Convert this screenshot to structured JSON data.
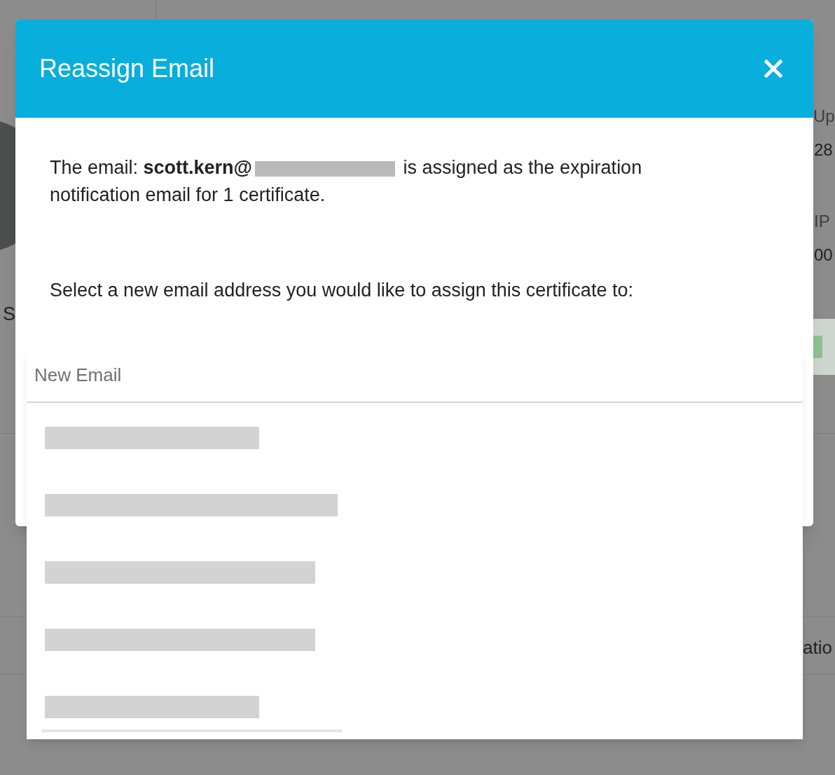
{
  "background_page": {
    "labels": [
      {
        "text": "Up",
        "kind": "label"
      },
      {
        "text": "28",
        "kind": "value"
      },
      {
        "text": "IP",
        "kind": "label"
      },
      {
        "text": "00",
        "kind": "value"
      }
    ],
    "left_label": "S",
    "lower_label": "atio"
  },
  "dialog": {
    "title": "Reassign Email",
    "message_before": "The email: **scott.kern@**",
    "message_after": "is assigned as the expiration notification email for 1 certificate.",
    "prompt": "Select a new email address you would like to assign this certificate to:",
    "email_field": {
      "placeholder": "New Email",
      "expanded": true
    }
  }
}
